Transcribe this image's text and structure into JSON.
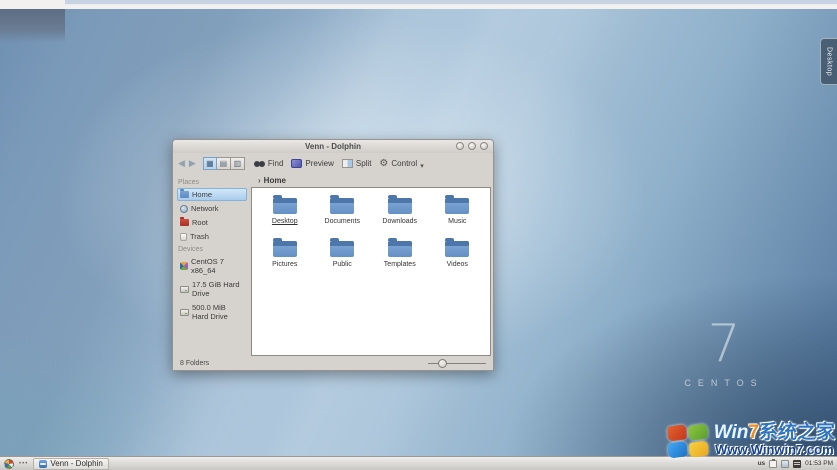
{
  "desktop": {
    "toolbox_label": "Desktop",
    "wallpaper_mark": {
      "big": "7",
      "brand": "CENTOS"
    }
  },
  "window": {
    "title": "Venn - Dolphin",
    "toolbar": {
      "find": "Find",
      "preview": "Preview",
      "split": "Split",
      "control": "Control"
    },
    "breadcrumb": "Home",
    "places": {
      "header": "Places",
      "items": [
        {
          "label": "Home",
          "selected": true
        },
        {
          "label": "Network"
        },
        {
          "label": "Root"
        },
        {
          "label": "Trash"
        }
      ]
    },
    "devices": {
      "header": "Devices",
      "items": [
        "CentOS 7 x86_64",
        "17.5 GiB Hard Drive",
        "500.0 MiB Hard Drive"
      ]
    },
    "folders": [
      "Desktop",
      "Documents",
      "Downloads",
      "Music",
      "Pictures",
      "Public",
      "Templates",
      "Videos"
    ],
    "statusbar": {
      "summary": "8 Folders"
    }
  },
  "taskbar": {
    "task_label": "Venn - Dolphin",
    "keyboard_layout": "us",
    "clock": "01:53 PM"
  },
  "watermark": {
    "win": "Win",
    "seven": "7",
    "cn": "系统之家",
    "url": "Www.Winwin7.com"
  },
  "icons": {
    "back": "◀",
    "forward": "▶",
    "view_icons": "▦",
    "view_compact": "▤",
    "view_details": "▥",
    "gear": "⚙",
    "caret_down": "▾",
    "breadcrumb_arrow": "›",
    "pager_dots": "•••"
  },
  "colors": {
    "selection_blue": "#a9cdec",
    "folder_blue": "#6490c4",
    "wallpaper_blue": "#8fb0ca",
    "watermark_orange": "#f08a1d",
    "watermark_blue": "#2f74c0"
  }
}
